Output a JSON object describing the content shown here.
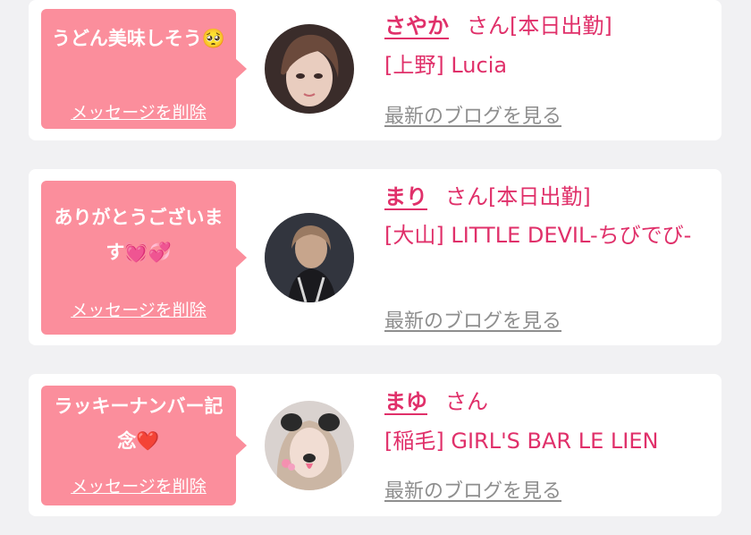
{
  "cards": [
    {
      "message": "うどん美味しそう🥺",
      "delete_label": "メッセージを削除",
      "cast_name": "さやか",
      "suffix": "さん[本日出勤]",
      "shop": "[上野] Lucia",
      "blog_label": "最新のブログを見る"
    },
    {
      "message": "ありがとうございます💓💞",
      "delete_label": "メッセージを削除",
      "cast_name": "まり",
      "suffix": "さん[本日出勤]",
      "shop": "[大山] LITTLE DEVIL-ちびでび-",
      "blog_label": "最新のブログを見る"
    },
    {
      "message": "ラッキーナンバー記念❤️",
      "delete_label": "メッセージを削除",
      "cast_name": "まゆ",
      "suffix": "さん",
      "shop": "[稲毛] GIRL'S BAR LE LIEN",
      "blog_label": "最新のブログを見る"
    }
  ],
  "colors": {
    "background": "#f1f1f3",
    "bubble": "#fb8e9c",
    "accent": "#e0306a",
    "link_gray": "#8e8e8e"
  }
}
